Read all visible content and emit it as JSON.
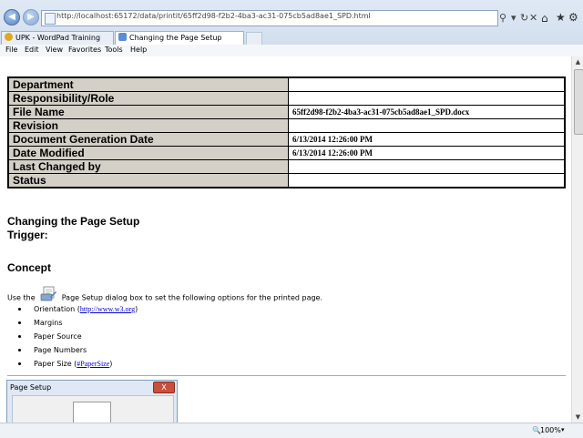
{
  "browser": {
    "url_host": "http://localhost",
    "url_rest": ":65172/data/printit/65ff2d98-f2b2-4ba3-ac31-075cb5ad8ae1_SPD.html",
    "tabs": [
      {
        "label": "UPK - WordPad Training"
      },
      {
        "label": "Changing the Page Setup"
      }
    ],
    "menu": [
      "File",
      "Edit",
      "View",
      "Favorites",
      "Tools",
      "Help"
    ],
    "zoom": "100%"
  },
  "properties": [
    {
      "key": "Department",
      "value": ""
    },
    {
      "key": "Responsibility/Role",
      "value": ""
    },
    {
      "key": "File Name",
      "value": "65ff2d98-f2b2-4ba3-ac31-075cb5ad8ae1_SPD.docx"
    },
    {
      "key": "Revision",
      "value": ""
    },
    {
      "key": "Document Generation Date",
      "value": "6/13/2014 12:26:00 PM"
    },
    {
      "key": "Date Modified",
      "value": "6/13/2014 12:26:00 PM"
    },
    {
      "key": "Last Changed by",
      "value": ""
    },
    {
      "key": "Status",
      "value": ""
    }
  ],
  "doc": {
    "title": "Changing the Page Setup",
    "trigger": "Trigger:",
    "concept_heading": "Concept",
    "use_prefix": "Use the",
    "use_suffix": "Page Setup dialog box to set the following options for the printed page.",
    "options": [
      {
        "text": "Orientation",
        "link": "http://www.w3.org",
        "link_wrap": [
          "(",
          ")"
        ]
      },
      {
        "text": "Margins"
      },
      {
        "text": "Paper Source"
      },
      {
        "text": "Page Numbers"
      },
      {
        "text": "Paper Size",
        "link": "#PaperSize",
        "link_wrap": [
          "(",
          ")"
        ]
      }
    ],
    "dialog_title": "Page Setup",
    "dialog_close": "X"
  }
}
